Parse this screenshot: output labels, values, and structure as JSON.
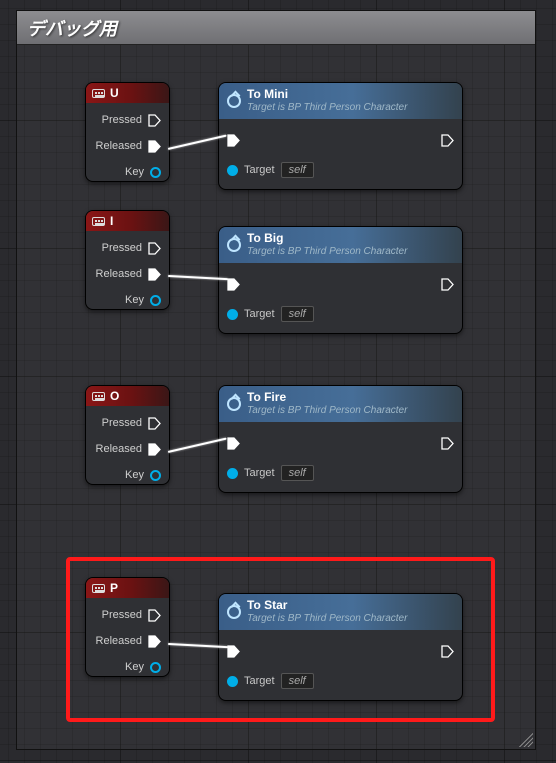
{
  "comment": {
    "title": "デバッグ用"
  },
  "blocks": [
    {
      "input": {
        "key": "U",
        "pins": {
          "pressed": "Pressed",
          "released": "Released",
          "key_out": "Key"
        }
      },
      "func": {
        "title": "To Mini",
        "subtitle": "Target is BP Third Person Character",
        "target_label": "Target",
        "target_value": "self"
      }
    },
    {
      "input": {
        "key": "I",
        "pins": {
          "pressed": "Pressed",
          "released": "Released",
          "key_out": "Key"
        }
      },
      "func": {
        "title": "To Big",
        "subtitle": "Target is BP Third Person Character",
        "target_label": "Target",
        "target_value": "self"
      }
    },
    {
      "input": {
        "key": "O",
        "pins": {
          "pressed": "Pressed",
          "released": "Released",
          "key_out": "Key"
        }
      },
      "func": {
        "title": "To Fire",
        "subtitle": "Target is BP Third Person Character",
        "target_label": "Target",
        "target_value": "self"
      }
    },
    {
      "input": {
        "key": "P",
        "pins": {
          "pressed": "Pressed",
          "released": "Released",
          "key_out": "Key"
        }
      },
      "func": {
        "title": "To Star",
        "subtitle": "Target is BP Third Person Character",
        "target_label": "Target",
        "target_value": "self"
      }
    }
  ]
}
